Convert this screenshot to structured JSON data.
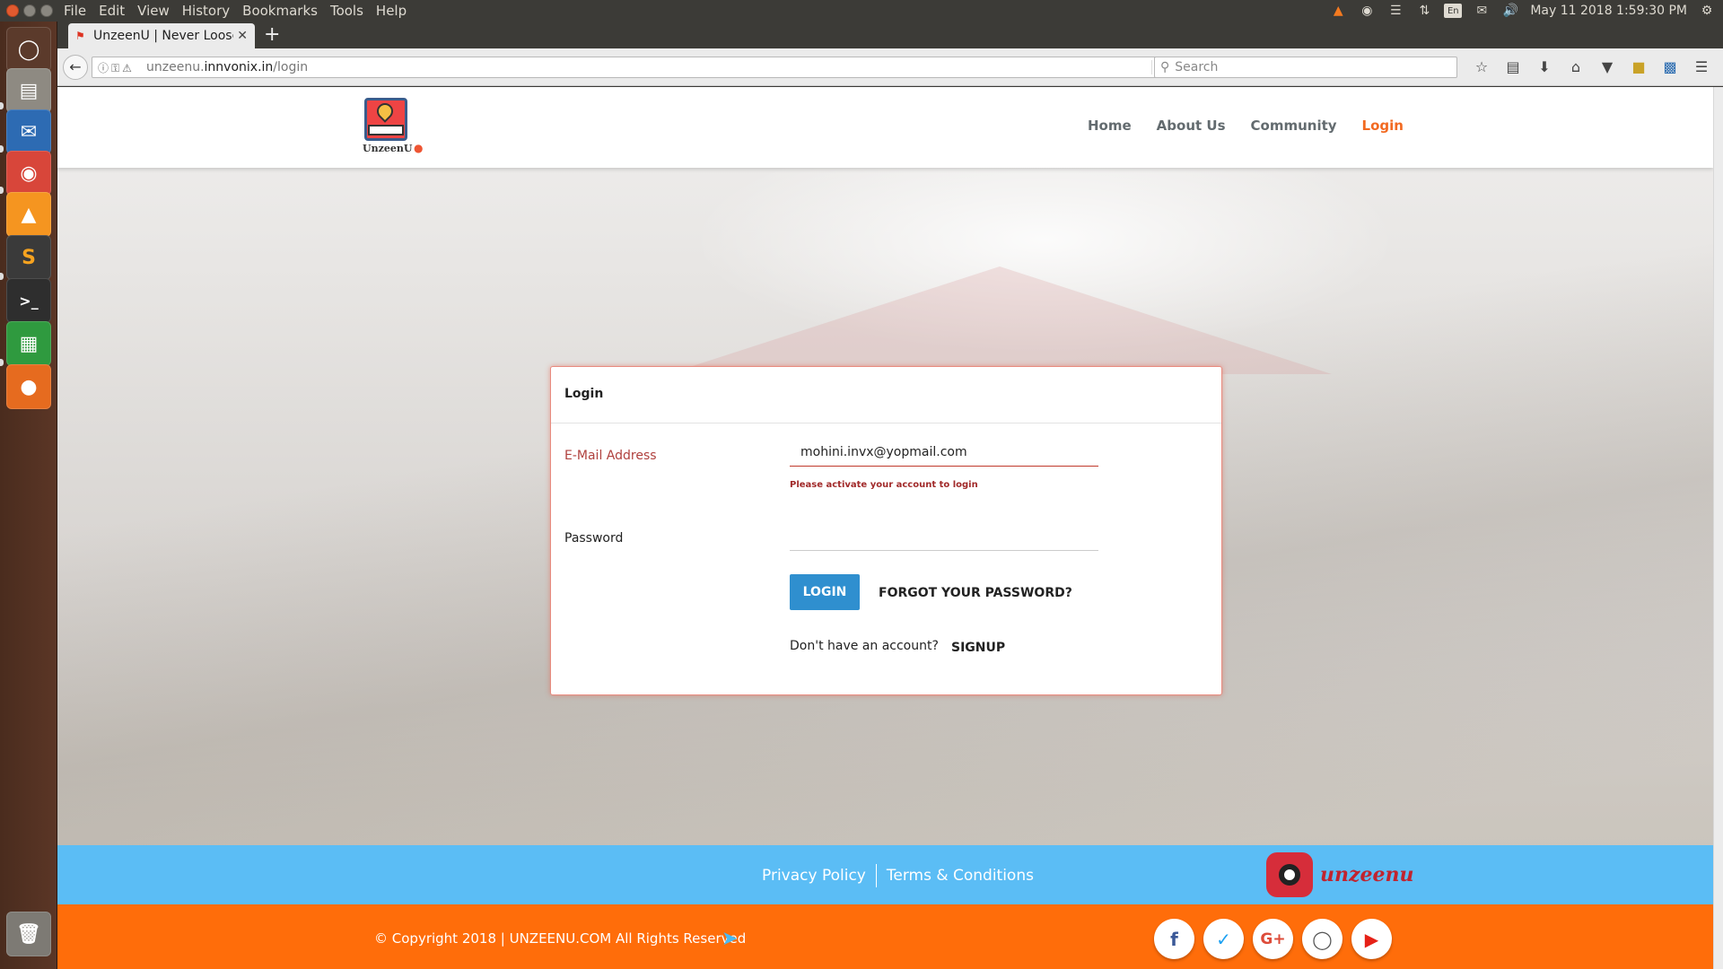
{
  "menubar": [
    "File",
    "Edit",
    "View",
    "History",
    "Bookmarks",
    "Tools",
    "Help"
  ],
  "tray": {
    "keyboard": "En",
    "datetime": "May 11 2018  1:59:30 PM"
  },
  "browser": {
    "tab_title": "UnzeenU | Never Loose",
    "url_host": "unzeenu.",
    "url_domain": "innvonix.in",
    "url_path": "/login",
    "search_placeholder": "Search"
  },
  "site": {
    "logo_text": "UnzeenU",
    "nav": [
      "Home",
      "About Us",
      "Community",
      "Login"
    ],
    "active_nav": "Login"
  },
  "login": {
    "title": "Login",
    "email_label": "E-Mail Address",
    "email_value": "mohini.invx@yopmail.com",
    "error": "Please activate your account to login",
    "password_label": "Password",
    "login_button": "LOGIN",
    "forgot": "FORGOT YOUR PASSWORD?",
    "no_account": "Don't have an account?",
    "signup": "SIGNUP"
  },
  "footer": {
    "privacy": "Privacy Policy",
    "terms": "Terms & Conditions",
    "brand": "unzeenu",
    "copyright": "© Copyright 2018 | UNZEENU.COM All Rights Reserved",
    "social": [
      "facebook-icon",
      "twitter-icon",
      "google-plus-icon",
      "instagram-icon",
      "youtube-icon"
    ]
  },
  "colors": {
    "accent": "#f26a21",
    "footer_top": "#5bbdf5",
    "footer_bottom": "#ff6d0a",
    "button": "#2f8fcf",
    "error": "#a12a2a"
  }
}
